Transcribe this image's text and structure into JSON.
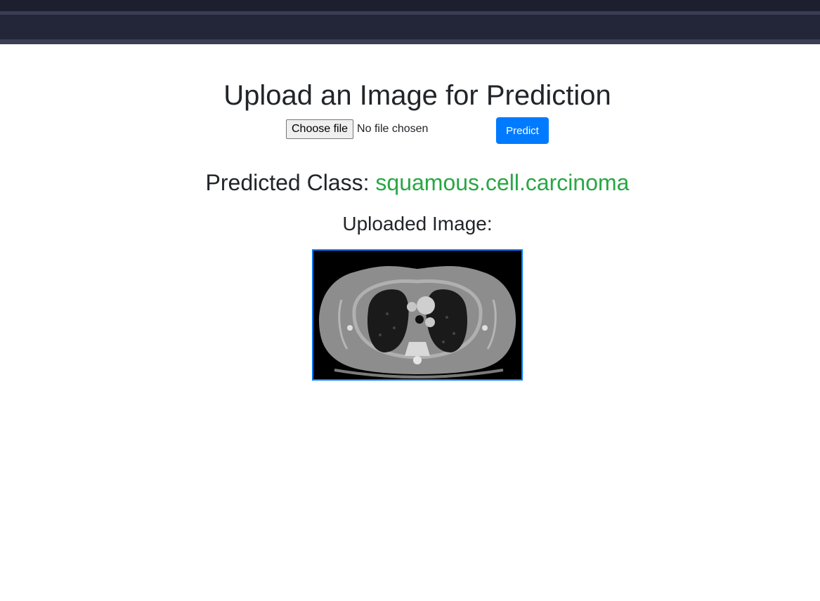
{
  "header": {
    "title": "Upload an Image for Prediction"
  },
  "upload": {
    "choose_file_label": "Choose file",
    "file_status": "No file chosen",
    "predict_label": "Predict"
  },
  "result": {
    "prefix": "Predicted Class:",
    "value": "squamous.cell.carcinoma"
  },
  "preview": {
    "heading": "Uploaded Image:",
    "image_alt": "CT scan of chest (axial slice)"
  },
  "colors": {
    "topbar": "#232539",
    "accent": "#007bff",
    "success": "#28a745",
    "text": "#212529"
  }
}
